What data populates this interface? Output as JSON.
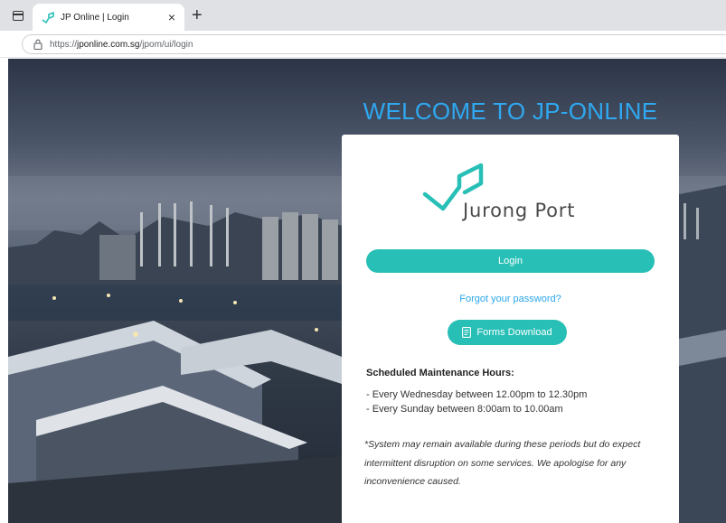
{
  "browser": {
    "tab_title": "JP Online | Login",
    "tab_close": "×",
    "new_tab": "+",
    "url_prefix": "https://",
    "url_domain": "jponline.com.sg",
    "url_path": "/jpom/ui/login"
  },
  "page": {
    "welcome": "WELCOME TO JP-ONLINE",
    "logo_text": "Jurong Port",
    "login_label": "Login",
    "forgot_label": "Forgot your password?",
    "forms_label": "Forms Download",
    "maintenance": {
      "title": "Scheduled Maintenance Hours:",
      "lines": [
        "- Every Wednesday between 12.00pm to 12.30pm",
        "- Every Sunday between 8:00am to 10.00am"
      ],
      "note": "*System may remain available during these periods but do expect intermittent disruption on some services. We apologise for any inconvenience caused."
    }
  },
  "colors": {
    "accent": "#28bfb6",
    "welcome": "#2fa8f0",
    "link": "#2aa7ea"
  },
  "icons": {
    "tab_menu": "tab-actions-icon",
    "favicon": "jp-logo-icon",
    "lock": "lock-icon",
    "forms": "document-icon"
  }
}
